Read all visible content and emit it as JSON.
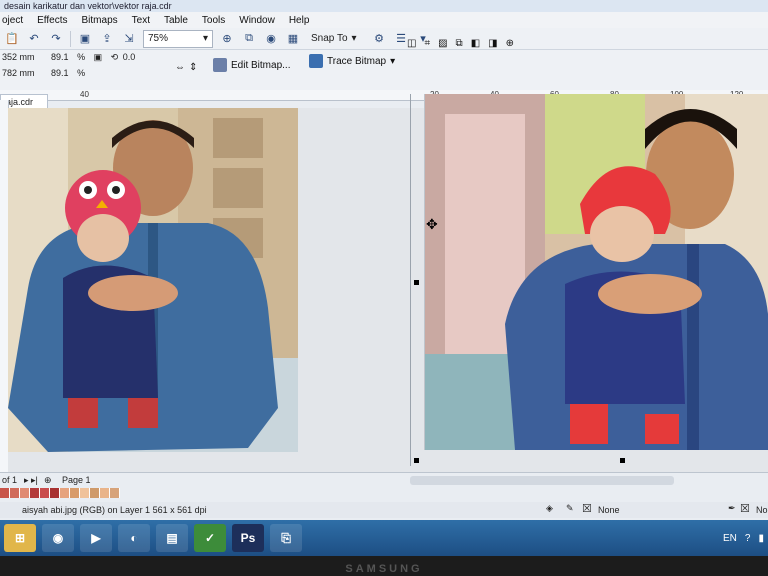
{
  "window": {
    "title": "desain karikatur dan vektor\\vektor raja.cdr"
  },
  "menu": [
    "oject",
    "Effects",
    "Bitmaps",
    "Text",
    "Table",
    "Tools",
    "Window",
    "Help"
  ],
  "toolbar": {
    "zoom": "75%",
    "snap_to": "Snap To",
    "edit_bitmap": "Edit Bitmap...",
    "trace_bitmap": "Trace Bitmap"
  },
  "properties": {
    "width": "352 mm",
    "height": "782 mm",
    "scale_x": "89.1",
    "scale_y": "89.1",
    "pct": "%",
    "rotation": "0.0"
  },
  "document_tab": "raja.cdr",
  "ruler_ticks": [
    "20",
    "40",
    "60",
    "80",
    "100",
    "120",
    "40"
  ],
  "page_nav": {
    "of": "of 1",
    "page": "Page 1"
  },
  "status": {
    "object": "aisyah abi.jpg (RGB) on Layer 1 561 x 561 dpi",
    "fill": "None",
    "outline": "No"
  },
  "taskbar": {
    "apps": [
      "start",
      "chrome",
      "media",
      "firefox",
      "photos",
      "corel",
      "photoshop",
      "usb"
    ],
    "ps_label": "Ps",
    "lang": "EN"
  },
  "monitor_brand": "SAMSUNG",
  "palette_colors": [
    "#c8554a",
    "#d06a5a",
    "#e08a72",
    "#b33b3b",
    "#c94c4c",
    "#a83232",
    "#e6a37e",
    "#d89b6a",
    "#f0c29a",
    "#cf9a6a",
    "#e9b48a",
    "#d7a37a"
  ]
}
